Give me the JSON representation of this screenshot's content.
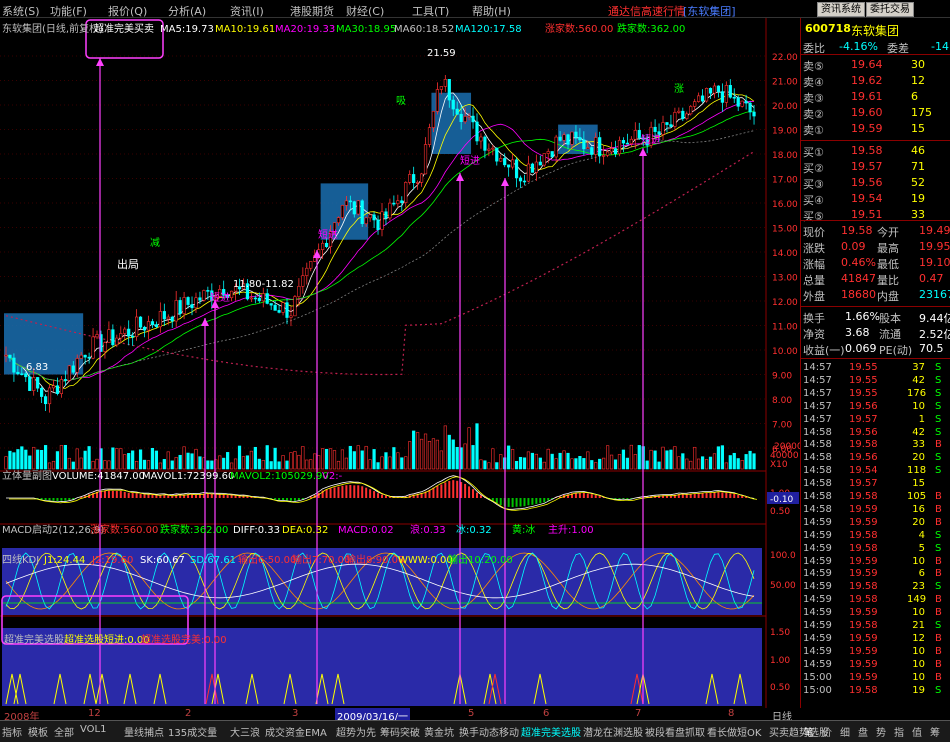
{
  "menu": [
    "系统(S)",
    "功能(F)",
    "报价(Q)",
    "分析(A)",
    "资讯(I)",
    "港股期货",
    "财经(C)",
    "工具(T)",
    "帮助(H)"
  ],
  "promo": "通达信高速行情",
  "stock_tag": "[东软集团]",
  "top_buttons": [
    "资讯系统",
    "委托交易"
  ],
  "main_title": "东软集团(日线,前复权)",
  "indicator_name": "超准完美买卖",
  "ma": [
    {
      "label": "MA5:19.73",
      "color": "#ffffff"
    },
    {
      "label": "MA10:19.61",
      "color": "#ffff00"
    },
    {
      "label": "MA20:19.33",
      "color": "#ff00ff"
    },
    {
      "label": "MA30:18.95",
      "color": "#00ff00"
    },
    {
      "label": "MA60:18.52",
      "color": "#c0c0c0"
    },
    {
      "label": "MA120:17.58",
      "color": "#00ffff"
    }
  ],
  "up_count": "涨家数:560.00",
  "down_count": "跌家数:362.00",
  "price_axis": [
    "22.00",
    "21.00",
    "20.00",
    "19.00",
    "18.00",
    "17.00",
    "16.00",
    "15.00",
    "14.00",
    "13.00",
    "12.00",
    "11.00",
    "10.00",
    "9.00",
    "8.00",
    "7.00",
    "6.00"
  ],
  "annotations": {
    "high": "21.59",
    "low": "6.83",
    "range": "11.80-11.82",
    "chuju": "出局",
    "jian": "减",
    "duanjin": "短进",
    "xi": "吸",
    "zhang": "涨"
  },
  "vol": {
    "title": "立体量副图",
    "volume": "VOLUME:41847.00",
    "mavol1": "MAVOL1:72399.60",
    "mavol2": "MAVOL2:105029.90",
    "v2": "V2:-",
    "axis": [
      "40000",
      "20000",
      "X10"
    ]
  },
  "macd": {
    "title": "MACD启动2(12,26,9)",
    "up": "涨家数:560.00",
    "down": "跌家数:362.00",
    "diff": "DIFF:0.33",
    "dea": "DEA:0.32",
    "macd": "MACD:0.02",
    "a": "浪:0.33",
    "b": "冰:0.32",
    "c": "黄:冰",
    "d": "主升:1.00",
    "axis": [
      "1.00",
      "0.50",
      "-0.10"
    ]
  },
  "kdj": {
    "title": "四线KDJ",
    "j1": "J1:24.44",
    "j2": "J2:19.60",
    "sk": "SK:60.67",
    "sd": "SD:67.61",
    "o1": "输出6:50.00",
    "o2": "输出7:70.00",
    "o3": "输出8:90.00",
    "w": "WWW:0.00",
    "o4": "输出10:20.00",
    "axis": [
      "100.0",
      "50.00"
    ]
  },
  "sel": {
    "title": "超准完美选股",
    "a": "超准选股短进:0.00",
    "b": "超准选股完美:0.00",
    "axis": [
      "1.50",
      "1.00",
      "0.50"
    ]
  },
  "time_axis": [
    "2008年",
    "12",
    "2",
    "3",
    "2009/03/16/一",
    "5",
    "6",
    "7",
    "8",
    "日线"
  ],
  "quote": {
    "code": "600718",
    "name": "东软集团",
    "weibi_label": "委比",
    "weibi": "-4.16%",
    "weicha_label": "委差",
    "weicha": "-14",
    "asks": [
      {
        "l": "卖⑤",
        "p": "19.64",
        "v": "30"
      },
      {
        "l": "卖④",
        "p": "19.62",
        "v": "12"
      },
      {
        "l": "卖③",
        "p": "19.61",
        "v": "6"
      },
      {
        "l": "卖②",
        "p": "19.60",
        "v": "175"
      },
      {
        "l": "卖①",
        "p": "19.59",
        "v": "15"
      }
    ],
    "bids": [
      {
        "l": "买①",
        "p": "19.58",
        "v": "46"
      },
      {
        "l": "买②",
        "p": "19.57",
        "v": "71"
      },
      {
        "l": "买③",
        "p": "19.56",
        "v": "52"
      },
      {
        "l": "买④",
        "p": "19.54",
        "v": "19"
      },
      {
        "l": "买⑤",
        "p": "19.51",
        "v": "33"
      }
    ],
    "stats": [
      {
        "a": "现价",
        "b": "19.58",
        "c": "今开",
        "d": "19.49"
      },
      {
        "a": "涨跌",
        "b": "0.09",
        "c": "最高",
        "d": "19.95"
      },
      {
        "a": "涨幅",
        "b": "0.46%",
        "c": "最低",
        "d": "19.10"
      },
      {
        "a": "总量",
        "b": "41847",
        "c": "量比",
        "d": "0.47"
      },
      {
        "a": "外盘",
        "b": "18680",
        "c": "内盘",
        "d": "23167"
      }
    ],
    "stats2": [
      {
        "a": "换手",
        "b": "1.66%",
        "c": "股本",
        "d": "9.44亿"
      },
      {
        "a": "净资",
        "b": "3.68",
        "c": "流通",
        "d": "2.52亿"
      },
      {
        "a": "收益(一)",
        "b": "0.069",
        "c": "PE(动)",
        "d": "70.5"
      }
    ]
  },
  "ticks": [
    [
      "14:57",
      "19.55",
      "37",
      "S"
    ],
    [
      "14:57",
      "19.55",
      "42",
      "S"
    ],
    [
      "14:57",
      "19.55",
      "176",
      "S"
    ],
    [
      "14:57",
      "19.56",
      "10",
      "S"
    ],
    [
      "14:57",
      "19.57",
      "1",
      "S"
    ],
    [
      "14:58",
      "19.56",
      "42",
      "S"
    ],
    [
      "14:58",
      "19.58",
      "33",
      "B"
    ],
    [
      "14:58",
      "19.56",
      "20",
      "S"
    ],
    [
      "14:58",
      "19.54",
      "118",
      "S"
    ],
    [
      "14:58",
      "19.57",
      "15",
      ""
    ],
    [
      "14:58",
      "19.58",
      "105",
      "B"
    ],
    [
      "14:58",
      "19.59",
      "16",
      "B"
    ],
    [
      "14:59",
      "19.59",
      "20",
      "B"
    ],
    [
      "14:59",
      "19.58",
      "4",
      "S"
    ],
    [
      "14:59",
      "19.58",
      "5",
      "S"
    ],
    [
      "14:59",
      "19.59",
      "10",
      "B"
    ],
    [
      "14:59",
      "19.59",
      "6",
      "B"
    ],
    [
      "14:59",
      "19.58",
      "23",
      "S"
    ],
    [
      "14:59",
      "19.58",
      "149",
      "B"
    ],
    [
      "14:59",
      "19.59",
      "10",
      "B"
    ],
    [
      "14:59",
      "19.58",
      "21",
      "S"
    ],
    [
      "14:59",
      "19.59",
      "12",
      "B"
    ],
    [
      "14:59",
      "19.59",
      "10",
      "B"
    ],
    [
      "14:59",
      "19.59",
      "10",
      "B"
    ],
    [
      "15:00",
      "19.59",
      "10",
      "B"
    ],
    [
      "15:00",
      "19.58",
      "19",
      "S"
    ]
  ],
  "bottom_tabs": [
    "指标",
    "模板",
    "全部",
    "VOL1",
    "量线捕点",
    "135成交量",
    "大三浪",
    "成交资金EMA",
    "超势为先",
    "筹码突破",
    "黄金坑",
    "换手动态移动",
    "超准完美选股",
    "潜龙在渊选股",
    "被段看盘抓取",
    "看长做短OK",
    "买卖趋势选股"
  ],
  "right_tabs": [
    "笔",
    "价",
    "细",
    "盘",
    "势",
    "指",
    "值",
    "筹"
  ],
  "colors": {
    "up": "#ff3030",
    "down": "#00ffff",
    "accent": "#ff00ff"
  }
}
